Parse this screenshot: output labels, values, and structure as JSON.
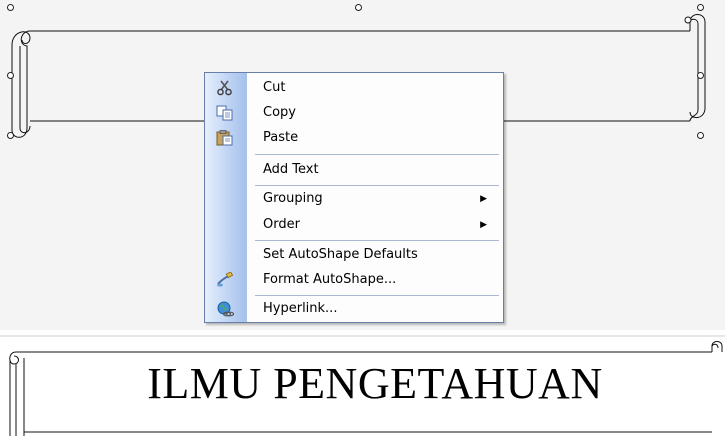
{
  "context_menu": {
    "items": [
      {
        "label": "Cut",
        "icon": "scissors-icon",
        "arrow": ""
      },
      {
        "label": "Copy",
        "icon": "copy-icon",
        "arrow": ""
      },
      {
        "label": "Paste",
        "icon": "clipboard-paste-icon",
        "arrow": ""
      },
      {
        "label": "Add Text",
        "icon": "",
        "arrow": ""
      },
      {
        "label": "Grouping",
        "icon": "",
        "arrow": "▶"
      },
      {
        "label": "Order",
        "icon": "",
        "arrow": "▶"
      },
      {
        "label": "Set AutoShape Defaults",
        "icon": "",
        "arrow": ""
      },
      {
        "label": "Format AutoShape...",
        "icon": "format-paintbrush-icon",
        "arrow": ""
      },
      {
        "label": "Hyperlink...",
        "icon": "globe-link-icon",
        "arrow": ""
      }
    ]
  },
  "banner": {
    "text": "ILMU PENGETAHUAN"
  },
  "colors": {
    "menu_border": "#6a7fa8",
    "menu_gutter": "#bcd2f3",
    "separator": "#a9b8d3"
  }
}
